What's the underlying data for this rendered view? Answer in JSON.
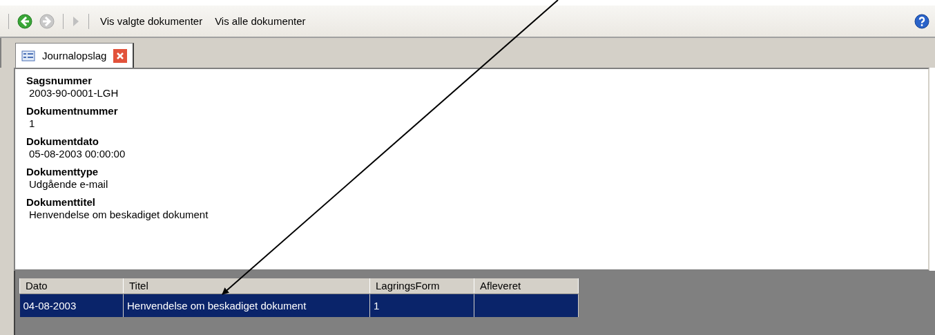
{
  "toolbar": {
    "nav_buttons": [
      {
        "kind": "back",
        "disabled": false
      },
      {
        "kind": "forward",
        "disabled": true
      },
      {
        "kind": "play",
        "disabled": true
      }
    ],
    "actions": [
      "Vis valgte dokumenter",
      "Vis alle dokumenter"
    ]
  },
  "tabs": [
    {
      "label": "Journalopslag",
      "selected": true
    }
  ],
  "fields": [
    {
      "label": "Sagsnummer",
      "value": "2003-90-0001-LGH"
    },
    {
      "label": "Dokumentnummer",
      "value": "1"
    },
    {
      "label": "Dokumentdato",
      "value": "05-08-2003 00:00:00"
    },
    {
      "label": "Dokumenttype",
      "value": "Udgående e-mail"
    },
    {
      "label": "Dokumenttitel",
      "value": "Henvendelse om beskadiget dokument"
    }
  ],
  "table": {
    "columns": [
      "Dato",
      "Titel",
      "LagringsForm",
      "Afleveret"
    ],
    "rows": [
      {
        "cells": [
          "04-08-2003",
          "Henvendelse om beskadiget dokument",
          "1",
          ""
        ],
        "selected": true
      }
    ]
  }
}
